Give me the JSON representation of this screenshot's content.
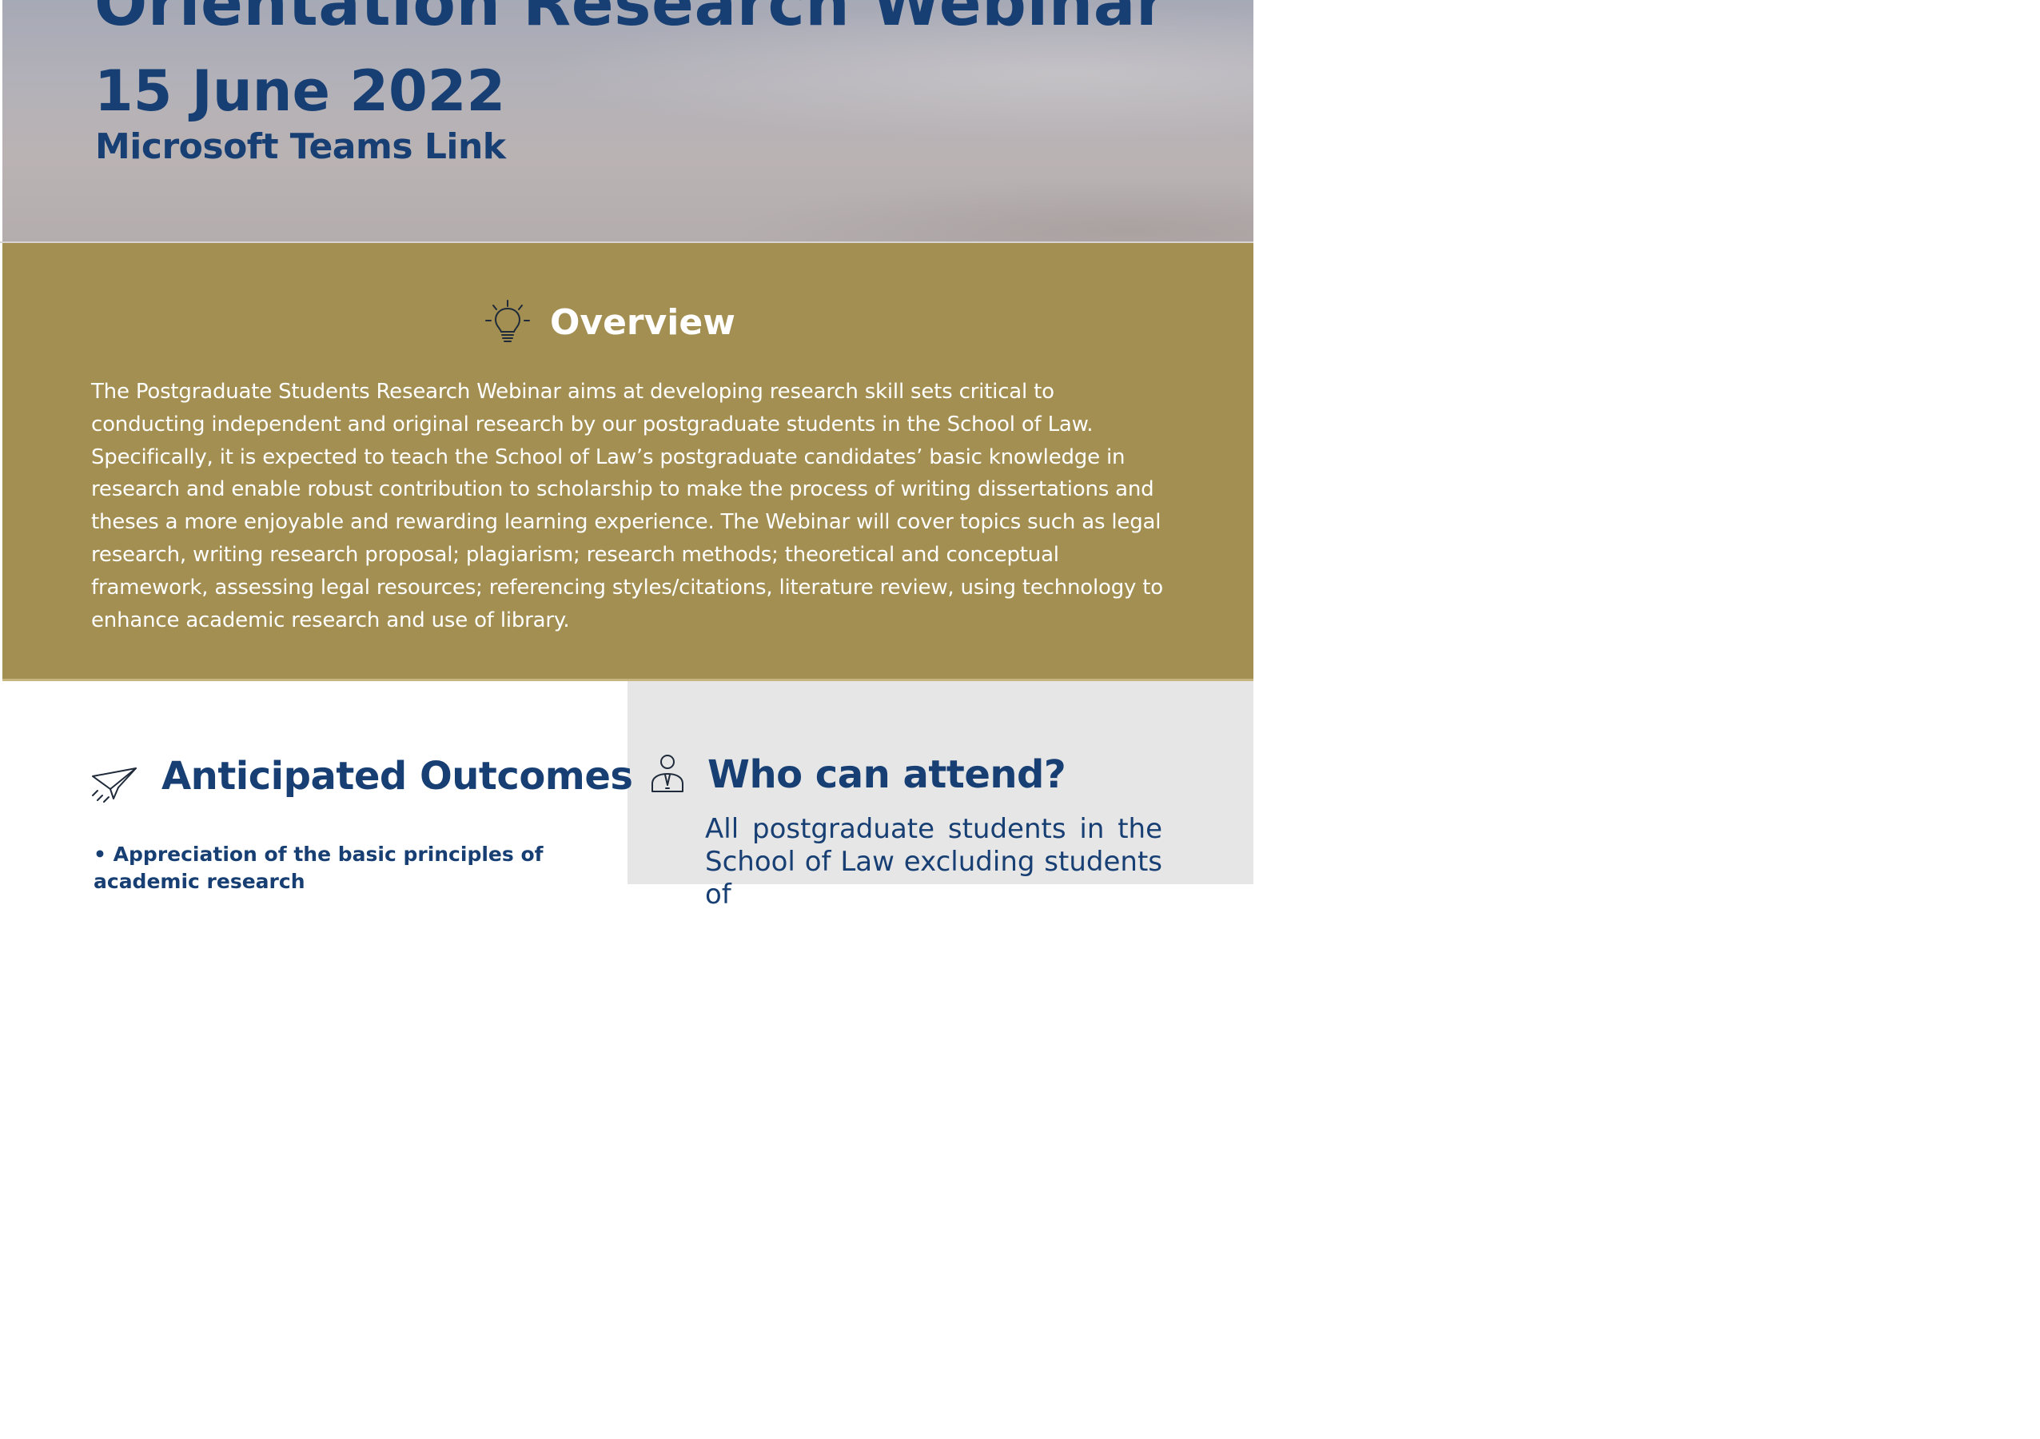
{
  "header": {
    "title": "Orientation Research Webinar",
    "date": "15 June 2022",
    "teams_link": "Microsoft Teams Link"
  },
  "overview": {
    "heading": "Overview",
    "icon": "lightbulb-icon",
    "body": "The Postgraduate Students Research Webinar aims at developing research skill sets critical to conducting independent and original research by our postgraduate students in the School of Law. Specifically, it is expected to teach the School of Law’s postgraduate candidates’ basic knowledge in research and enable robust contribution to scholarship to make the process of writing dissertations and theses a more enjoyable and rewarding learning experience. The Webinar will cover topics such as legal research, writing research proposal; plagiarism; research methods; theoretical and conceptual framework, assessing legal resources; referencing styles/citations, literature review, using technology to enhance academic research and use of library."
  },
  "outcomes": {
    "heading": "Anticipated Outcomes",
    "icon": "paper-plane-icon",
    "items": [
      "• Appreciation of the basic principles of academic research"
    ]
  },
  "attend": {
    "heading": "Who can attend?",
    "icon": "person-icon",
    "body": "All postgraduate students in the School of Law excluding students of"
  },
  "colors": {
    "navy": "#173f73",
    "gold": "#a38f52",
    "light_gray": "#e6e6e6"
  }
}
